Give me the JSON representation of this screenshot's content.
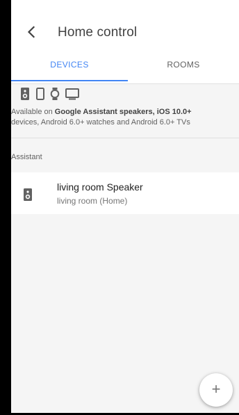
{
  "header": {
    "back_icon": "arrow-back-icon",
    "title": "Home control"
  },
  "tabs": [
    {
      "label": "DEVICES",
      "selected": true
    },
    {
      "label": "ROOMS",
      "selected": false
    }
  ],
  "availability": {
    "icons": [
      "speaker-icon",
      "phone-icon",
      "watch-icon",
      "tv-icon"
    ],
    "text_prefix": "Available on ",
    "text_bold": "Google Assistant speakers, iOS 10.0+",
    "text_line2": "devices, Android 6.0+ watches and Android 6.0+ TVs"
  },
  "section": {
    "header": "Assistant"
  },
  "devices": [
    {
      "icon": "speaker-icon",
      "name": "living room Speaker",
      "location": "living room (Home)"
    }
  ],
  "fab": {
    "icon": "add-icon",
    "symbol": "+"
  },
  "colors": {
    "accent": "#4285f4",
    "background": "#f5f5f5"
  }
}
